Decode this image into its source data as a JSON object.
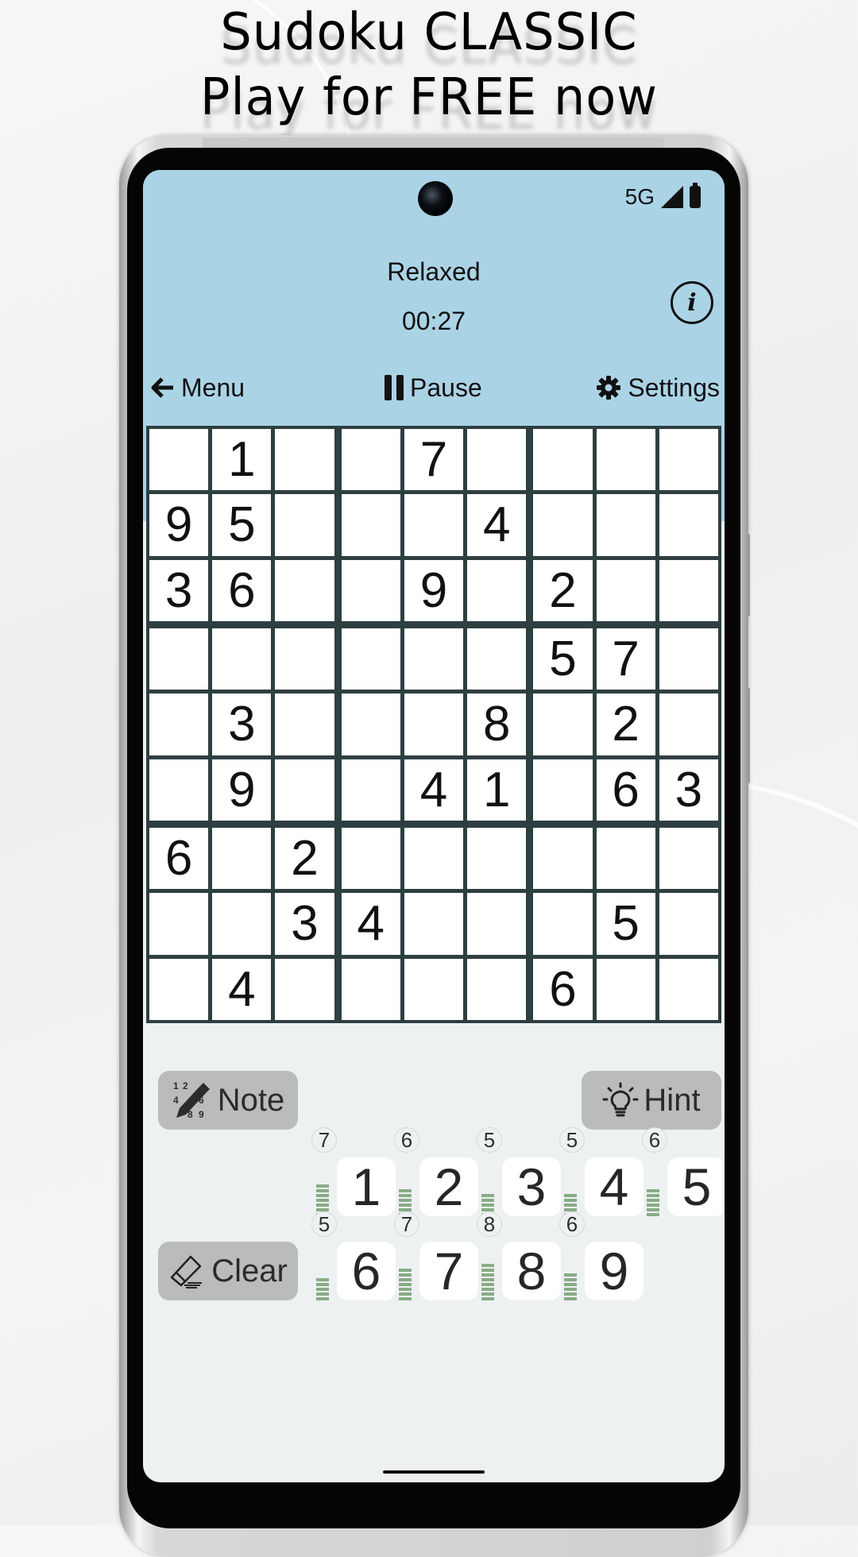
{
  "promo": {
    "line1": "Sudoku CLASSIC",
    "line2": "Play for FREE now"
  },
  "status_bar": {
    "network": "5G",
    "icons": [
      "signal-icon",
      "battery-icon"
    ]
  },
  "header": {
    "mode": "Relaxed",
    "timer": "00:27",
    "info_icon": "info-icon"
  },
  "toolbar": {
    "menu_label": "Menu",
    "menu_icon": "arrow-left-icon",
    "pause_label": "Pause",
    "pause_icon": "pause-icon",
    "settings_label": "Settings",
    "settings_icon": "gear-icon"
  },
  "grid": [
    [
      "",
      "1",
      "",
      "",
      "7",
      "",
      "",
      "",
      ""
    ],
    [
      "9",
      "5",
      "",
      "",
      "",
      "4",
      "",
      "",
      ""
    ],
    [
      "3",
      "6",
      "",
      "",
      "9",
      "",
      "2",
      "",
      ""
    ],
    [
      "",
      "",
      "",
      "",
      "",
      "",
      "5",
      "7",
      ""
    ],
    [
      "",
      "3",
      "",
      "",
      "",
      "8",
      "",
      "2",
      ""
    ],
    [
      "",
      "9",
      "",
      "",
      "4",
      "1",
      "",
      "6",
      "3"
    ],
    [
      "6",
      "",
      "2",
      "",
      "",
      "",
      "",
      "",
      ""
    ],
    [
      "",
      "",
      "3",
      "4",
      "",
      "",
      "",
      "5",
      ""
    ],
    [
      "",
      "4",
      "",
      "",
      "",
      "",
      "6",
      "",
      ""
    ]
  ],
  "actions": {
    "note_label": "Note",
    "hint_label": "Hint",
    "clear_label": "Clear"
  },
  "number_pad": [
    {
      "digit": "1",
      "remaining": 7
    },
    {
      "digit": "2",
      "remaining": 6
    },
    {
      "digit": "3",
      "remaining": 5
    },
    {
      "digit": "4",
      "remaining": 5
    },
    {
      "digit": "5",
      "remaining": 6
    },
    {
      "digit": "6",
      "remaining": 5
    },
    {
      "digit": "7",
      "remaining": 7
    },
    {
      "digit": "8",
      "remaining": 8
    },
    {
      "digit": "9",
      "remaining": 6
    }
  ],
  "colors": {
    "header_bg": "#abd3e6",
    "grid_line": "#2e3f41",
    "screen_bg": "#eef1f2",
    "button_bg": "#babcbc",
    "bar_green": "#88ac86"
  }
}
